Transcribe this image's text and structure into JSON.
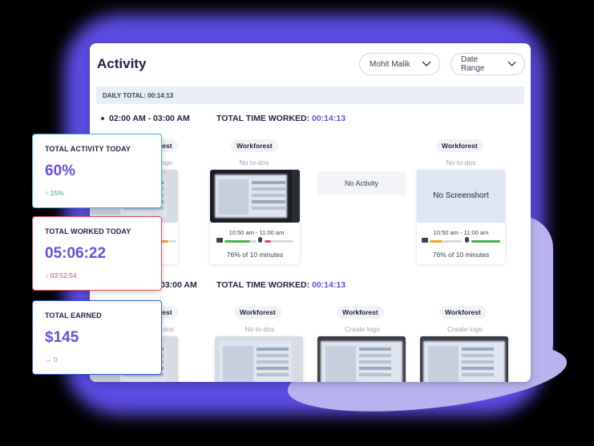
{
  "header": {
    "title": "Activity"
  },
  "filters": {
    "user": "Mohit Malik",
    "date": "Date Range"
  },
  "daily_total": "DAILY TOTAL: 00:14:13",
  "slots": [
    {
      "time": "02:00 AM - 03:00 AM",
      "ttw_label": "TOTAL TIME WORKED:",
      "ttw_value": "00:14:13"
    },
    {
      "time": "03:00 AM - 04:00 AM",
      "time_visible": "03:00 AM",
      "ttw_label": "TOTAL TIME WORKED:",
      "ttw_value": "00:14:13"
    }
  ],
  "row1": [
    {
      "project": "Workforest",
      "todo": "Create logo",
      "project_visible": "rest",
      "todo_visible": "logo",
      "range": "10:50 am - 11:00 am",
      "pct_visible": "inutes",
      "activity": 0.76
    },
    {
      "project": "Workforest",
      "todo": "No to-dos",
      "range": "10:50 am - 11:00 am",
      "pct": "76% of 10 minutes",
      "activity": 0.76
    },
    {
      "no_activity": "No Activity"
    },
    {
      "project": "Workforest",
      "todo": "No to-dos",
      "no_screenshot": "No Screenshort",
      "range": "10:50 am - 11:00 am",
      "pct": "76% of 10 minutes",
      "activity": 0.76
    }
  ],
  "row2": [
    {
      "project": "Workforest",
      "todo": "No to-dos",
      "project_visible": "rest",
      "todo_visible": "dos"
    },
    {
      "project": "Workforest",
      "todo": "No to-dos"
    },
    {
      "project": "Workforest",
      "todo": "Create logo"
    },
    {
      "project": "Workforest",
      "todo": "Create logo"
    }
  ],
  "stats": [
    {
      "label": "TOTAL ACTIVITY TODAY",
      "value": "60%",
      "change": "↑ 15%",
      "trend": "up",
      "border": "#42b8d6"
    },
    {
      "label": "TOTAL WORKED TODAY",
      "value": "05:06:22",
      "change": "↓ 03:52:54",
      "trend": "down",
      "border": "#e24a5a"
    },
    {
      "label": "TOTAL EARNED",
      "value": "$145",
      "change": "→ 0",
      "trend": "flat",
      "border": "#3b5bdb"
    }
  ],
  "colors": {
    "accent": "#6c4fd8",
    "purple_bg": "#5b4ce3",
    "green": "#2aa771",
    "red": "#e24a5a",
    "orange": "#f5a623"
  }
}
